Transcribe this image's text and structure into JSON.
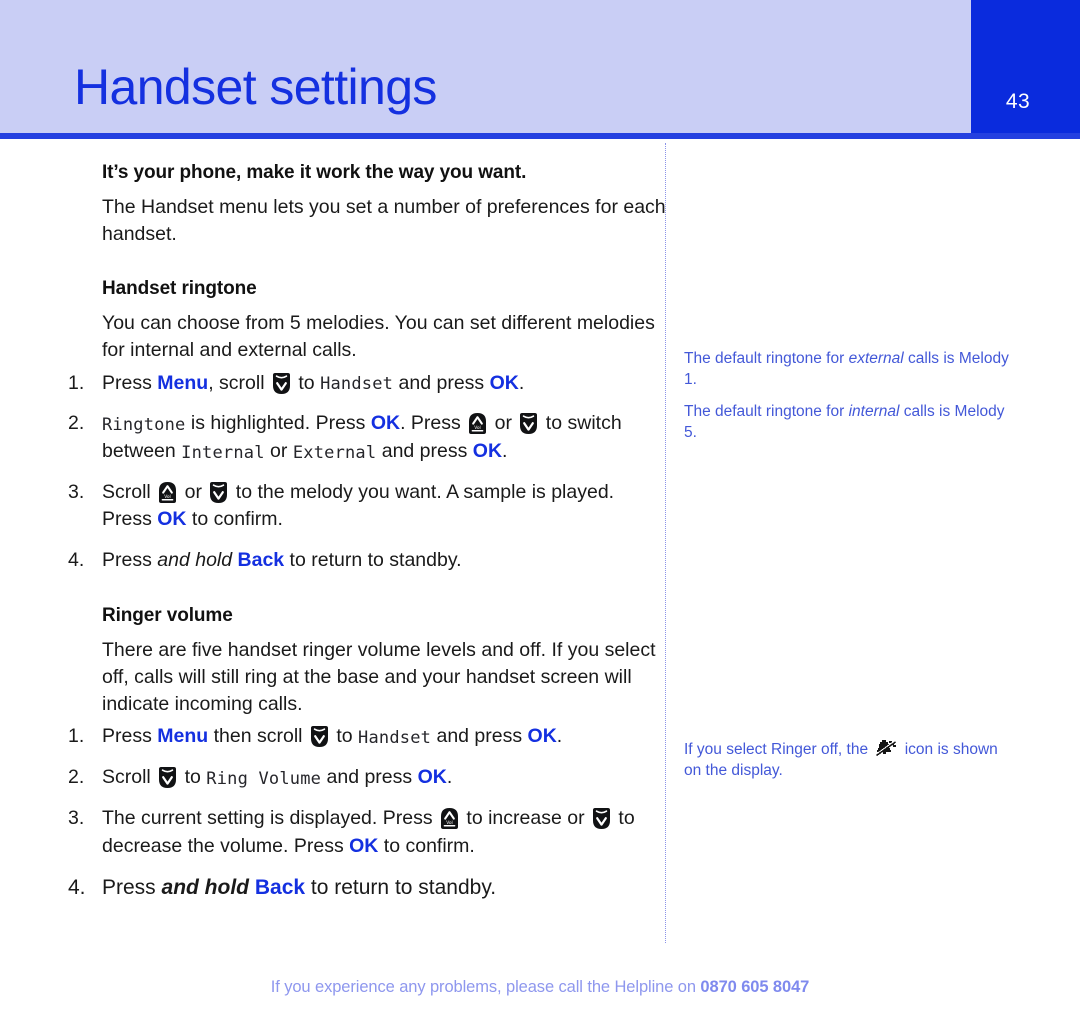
{
  "header": {
    "title": "Handset settings",
    "page_number": "43",
    "bg_color": "#c9cef5",
    "title_color": "#1430e0",
    "tab_color": "#0a2bdd",
    "rule_color": "#2440e0"
  },
  "main": {
    "lead": "It’s your phone, make it work the way you want.",
    "intro": "The Handset menu lets you set a number of preferences for each handset.",
    "section_1": {
      "heading": "Handset ringtone",
      "body": "You can choose from 5 melodies. You can set different melodies for internal and external calls.",
      "steps": [
        {
          "num": "1.",
          "parts": [
            {
              "t": "text",
              "v": "Press "
            },
            {
              "t": "kw",
              "v": "Menu"
            },
            {
              "t": "text",
              "v": ", scroll "
            },
            {
              "t": "icon",
              "v": "scroll-down-key-icon"
            },
            {
              "t": "text",
              "v": " to "
            },
            {
              "t": "lcd",
              "v": "Handset"
            },
            {
              "t": "text",
              "v": " and press "
            },
            {
              "t": "kw",
              "v": "OK"
            },
            {
              "t": "text",
              "v": "."
            }
          ]
        },
        {
          "num": "2.",
          "parts": [
            {
              "t": "lcd",
              "v": "Ringtone"
            },
            {
              "t": "text",
              "v": " is highlighted. Press "
            },
            {
              "t": "kw",
              "v": "OK"
            },
            {
              "t": "text",
              "v": ". Press "
            },
            {
              "t": "icon",
              "v": "scroll-up-key-icon"
            },
            {
              "t": "text",
              "v": " or "
            },
            {
              "t": "icon",
              "v": "scroll-down-key-icon"
            },
            {
              "t": "text",
              "v": " to switch between "
            },
            {
              "t": "lcd",
              "v": "Internal"
            },
            {
              "t": "text",
              "v": " or "
            },
            {
              "t": "lcd",
              "v": "External"
            },
            {
              "t": "text",
              "v": " and press "
            },
            {
              "t": "kw",
              "v": "OK"
            },
            {
              "t": "text",
              "v": "."
            }
          ]
        },
        {
          "num": "3.",
          "parts": [
            {
              "t": "text",
              "v": "Scroll "
            },
            {
              "t": "icon",
              "v": "scroll-up-key-icon"
            },
            {
              "t": "text",
              "v": " or "
            },
            {
              "t": "icon",
              "v": "scroll-down-key-icon"
            },
            {
              "t": "text",
              "v": " to the melody you want. A sample is played. Press "
            },
            {
              "t": "kw",
              "v": "OK"
            },
            {
              "t": "text",
              "v": " to confirm."
            }
          ]
        },
        {
          "num": "4.",
          "parts": [
            {
              "t": "text",
              "v": "Press "
            },
            {
              "t": "ital",
              "v": "and hold"
            },
            {
              "t": "text",
              "v": " "
            },
            {
              "t": "kw",
              "v": "Back"
            },
            {
              "t": "text",
              "v": " to return to standby."
            }
          ]
        }
      ]
    },
    "section_2": {
      "heading": "Ringer volume",
      "body": "There are five handset ringer volume levels and off. If you select off, calls will still ring at the base and your handset screen will indicate incoming calls.",
      "steps": [
        {
          "num": "1.",
          "parts": [
            {
              "t": "text",
              "v": "Press "
            },
            {
              "t": "kw",
              "v": "Menu"
            },
            {
              "t": "text",
              "v": " then scroll "
            },
            {
              "t": "icon",
              "v": "scroll-down-key-icon"
            },
            {
              "t": "text",
              "v": " to "
            },
            {
              "t": "lcd",
              "v": "Handset"
            },
            {
              "t": "text",
              "v": " and press "
            },
            {
              "t": "kw",
              "v": "OK"
            },
            {
              "t": "text",
              "v": "."
            }
          ]
        },
        {
          "num": "2.",
          "parts": [
            {
              "t": "text",
              "v": "Scroll "
            },
            {
              "t": "icon",
              "v": "scroll-down-key-icon"
            },
            {
              "t": "text",
              "v": " to "
            },
            {
              "t": "lcd",
              "v": "Ring Volume"
            },
            {
              "t": "text",
              "v": " and press "
            },
            {
              "t": "kw",
              "v": "OK"
            },
            {
              "t": "text",
              "v": "."
            }
          ]
        },
        {
          "num": "3.",
          "parts": [
            {
              "t": "text",
              "v": "The current setting is displayed. Press "
            },
            {
              "t": "icon",
              "v": "scroll-up-key-icon"
            },
            {
              "t": "text",
              "v": " to increase or "
            },
            {
              "t": "icon",
              "v": "scroll-down-key-icon"
            },
            {
              "t": "text",
              "v": " to decrease the volume. Press "
            },
            {
              "t": "kw",
              "v": "OK"
            },
            {
              "t": "text",
              "v": " to confirm."
            }
          ]
        },
        {
          "num": "4.",
          "big": true,
          "parts": [
            {
              "t": "text",
              "v": "Press "
            },
            {
              "t": "bital",
              "v": "and hold"
            },
            {
              "t": "text",
              "v": " "
            },
            {
              "t": "kw",
              "v": "Back"
            },
            {
              "t": "text",
              "v": " to return to standby."
            }
          ]
        }
      ]
    }
  },
  "sidebar": {
    "color": "#4358d8",
    "notes": [
      {
        "id": "note-default-external",
        "parts": [
          {
            "t": "text",
            "v": "The default ringtone for "
          },
          {
            "t": "ital",
            "v": "external"
          },
          {
            "t": "text",
            "v": " calls is Melody 1."
          }
        ]
      },
      {
        "id": "note-default-internal",
        "parts": [
          {
            "t": "text",
            "v": "The default ringtone for "
          },
          {
            "t": "ital",
            "v": "internal"
          },
          {
            "t": "text",
            "v": " calls is Melody 5."
          }
        ]
      },
      {
        "id": "note-ringer-off",
        "parts": [
          {
            "t": "text",
            "v": "If you select Ringer off, the "
          },
          {
            "t": "icon",
            "v": "ringer-off-icon"
          },
          {
            "t": "text",
            "v": " icon is shown on the display."
          }
        ]
      }
    ]
  },
  "footer": {
    "text": "If you experience any problems, please call the Helpline on ",
    "phone": "0870 605 8047",
    "color": "#8e97ee"
  }
}
